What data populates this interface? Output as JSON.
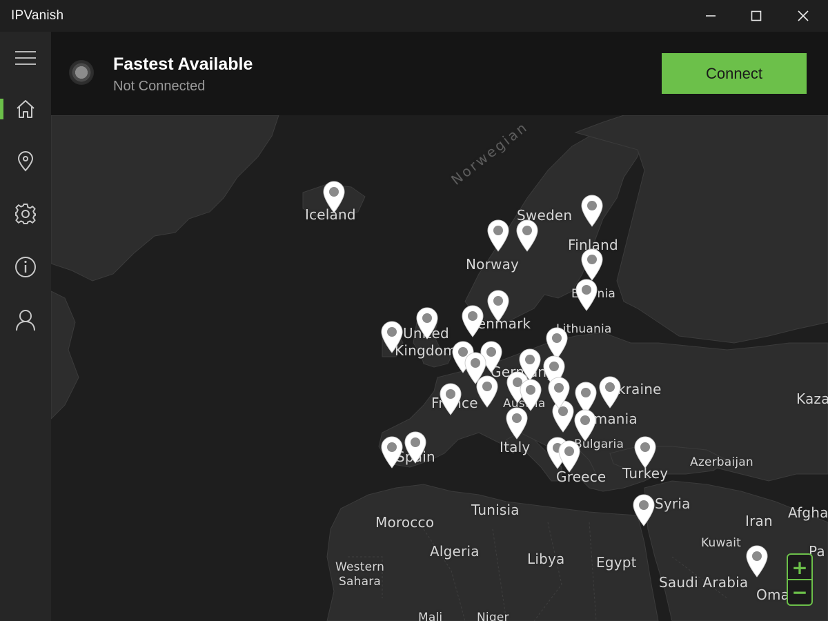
{
  "window": {
    "title": "IPVanish"
  },
  "sidebar": {
    "items": [
      {
        "name": "menu",
        "icon": "hamburger-menu-icon"
      },
      {
        "name": "home",
        "icon": "home-icon",
        "active": true
      },
      {
        "name": "locations",
        "icon": "location-pin-icon"
      },
      {
        "name": "settings",
        "icon": "gear-icon"
      },
      {
        "name": "info",
        "icon": "info-icon"
      },
      {
        "name": "account",
        "icon": "user-icon"
      }
    ]
  },
  "status": {
    "server_name": "Fastest Available",
    "connection_status": "Not Connected",
    "connect_label": "Connect"
  },
  "map": {
    "labels": {
      "norwegian_sea": "Norwegian",
      "iceland": "Iceland",
      "sweden": "Sweden",
      "finland": "Finland",
      "norway": "Norway",
      "estonia": "Estonia",
      "denmark": "Denmark",
      "lithuania": "Lithuania",
      "united": "United",
      "kingdom": "Kingdom",
      "germany": "Germany",
      "ukraine": "Ukraine",
      "france": "France",
      "austria": "Austria",
      "romania": "Romania",
      "kazakhstan": "Kaza",
      "spain": "Spain",
      "italy": "Italy",
      "bulgaria": "Bulgaria",
      "turkey": "Turkey",
      "azerbaijan": "Azerbaijan",
      "greece": "Greece",
      "tunisia": "Tunisia",
      "morocco": "Morocco",
      "syria": "Syria",
      "iran": "Iran",
      "afghanistan": "Afgha",
      "algeria": "Algeria",
      "libya": "Libya",
      "egypt": "Egypt",
      "kuwait": "Kuwait",
      "pakistan": "Pa",
      "western": "Western",
      "sahara": "Sahara",
      "saudi_arabia": "Saudi Arabia",
      "oman": "Oman",
      "mali": "Mali",
      "niger": "Niger"
    },
    "zoom_in_label": "+",
    "zoom_out_label": "−"
  }
}
